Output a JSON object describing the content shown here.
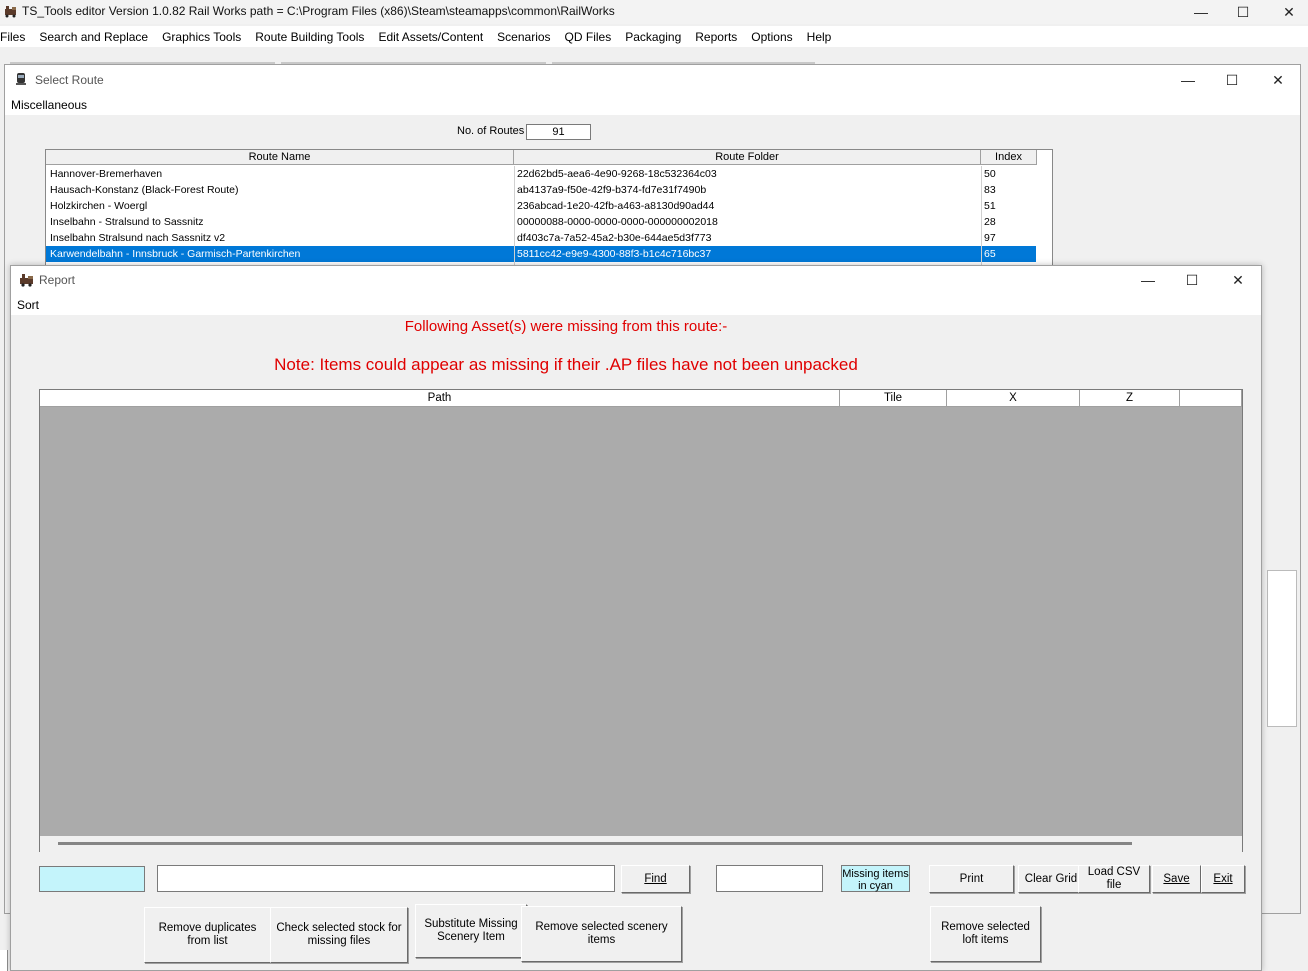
{
  "main_window": {
    "title": "TS_Tools editor  Version 1.0.82   Rail Works path = C:\\Program Files (x86)\\Steam\\steamapps\\common\\RailWorks",
    "menu": [
      "Files",
      "Search and Replace",
      "Graphics Tools",
      "Route Building Tools",
      "Edit Assets/Content",
      "Scenarios",
      "QD Files",
      "Packaging",
      "Reports",
      "Options",
      "Help"
    ],
    "controls": {
      "minimize": "—",
      "maximize": "☐",
      "close": "✕"
    }
  },
  "select_route": {
    "title": "Select Route",
    "menu": "Miscellaneous",
    "no_of_routes_label": "No. of Routes",
    "no_of_routes_value": "91",
    "columns": [
      "Route Name",
      "Route Folder",
      "Index"
    ],
    "rows": [
      {
        "name": "Hannover-Bremerhaven",
        "folder": "22d62bd5-aea6-4e90-9268-18c532364c03",
        "index": "50"
      },
      {
        "name": "Hausach-Konstanz (Black-Forest Route)",
        "folder": "ab4137a9-f50e-42f9-b374-fd7e31f7490b",
        "index": "83"
      },
      {
        "name": "Holzkirchen - Woergl",
        "folder": "236abcad-1e20-42fb-a463-a8130d90ad44",
        "index": "51"
      },
      {
        "name": "Inselbahn - Stralsund to Sassnitz",
        "folder": "00000088-0000-0000-0000-000000002018",
        "index": "28"
      },
      {
        "name": "Inselbahn Stralsund nach Sassnitz v2",
        "folder": "df403c7a-7a52-45a2-b30e-644ae5d3f773",
        "index": "97"
      },
      {
        "name": "Karwendelbahn - Innsbruck - Garmisch-Partenkirchen",
        "folder": "5811cc42-e9e9-4300-88f3-b1c4c716bc37",
        "index": "65"
      }
    ],
    "selected_row": 5,
    "selection_color": "#0078d7"
  },
  "report": {
    "title": "Report",
    "menu": "Sort",
    "heading": "Following Asset(s) were missing from this route:-",
    "note": "Note: Items could appear as missing if their .AP files have not been unpacked",
    "heading_color": "#e00000",
    "columns": [
      "Path",
      "Tile",
      "X",
      "Z"
    ],
    "search_value": "",
    "count_value": "",
    "legend_label": "Missing items in cyan",
    "legend_color": "#c4f4fb",
    "buttons": {
      "find": "Find",
      "print": "Print",
      "clear_grid": "Clear Grid",
      "load_csv": "Load CSV file",
      "save": "Save",
      "exit": "Exit",
      "remove_duplicates": "Remove duplicates from list",
      "check_stock": "Check selected stock for missing files",
      "substitute": "Substitute Missing Scenery Item",
      "remove_scenery": "Remove selected scenery items",
      "remove_loft": "Remove selected loft items"
    }
  }
}
